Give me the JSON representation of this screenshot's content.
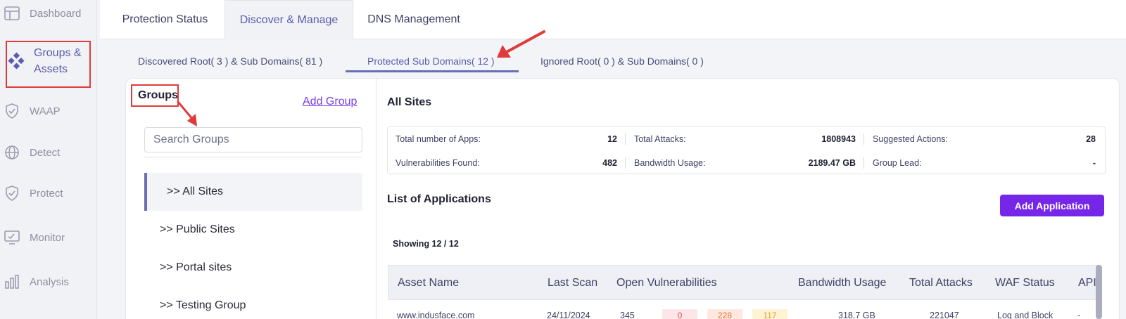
{
  "sidebar": {
    "items": [
      {
        "label": "Dashboard",
        "icon": "dashboard-icon"
      },
      {
        "label": "Groups &",
        "label2": "Assets",
        "icon": "groups-assets-icon"
      },
      {
        "label": "WAAP",
        "icon": "shield-check-icon"
      },
      {
        "label": "Detect",
        "icon": "detect-globe-icon"
      },
      {
        "label": "Protect",
        "icon": "shield-check-icon"
      },
      {
        "label": "Monitor",
        "icon": "monitor-icon"
      },
      {
        "label": "Analysis",
        "icon": "bar-chart-icon"
      }
    ]
  },
  "top_tabs": [
    "Protection Status",
    "Discover & Manage",
    "DNS Management"
  ],
  "sub_tabs": [
    "Discovered Root( 3 ) & Sub Domains( 81 )",
    "Protected Sub Domains( 12 )",
    "Ignored Root( 0 ) & Sub Domains( 0 )"
  ],
  "groups": {
    "title": "Groups",
    "add_label": "Add Group",
    "search_placeholder": "Search Groups",
    "items": [
      ">> All Sites",
      ">> Public Sites",
      ">> Portal sites",
      ">> Testing Group"
    ]
  },
  "all_sites": {
    "title": "All Sites",
    "stats": [
      {
        "label": "Total number of Apps:",
        "value": "12"
      },
      {
        "label": "Total Attacks:",
        "value": "1808943"
      },
      {
        "label": "Suggested Actions:",
        "value": "28"
      },
      {
        "label": "Vulnerabilities Found:",
        "value": "482"
      },
      {
        "label": "Bandwidth Usage:",
        "value": "2189.47 GB"
      },
      {
        "label": "Group Lead:",
        "value": "-"
      }
    ]
  },
  "applications": {
    "title": "List of Applications",
    "add_label": "Add Application",
    "showing": "Showing 12 / 12",
    "columns": [
      "Asset Name",
      "Last Scan",
      "Open Vulnerabilities",
      "Bandwidth Usage",
      "Total Attacks",
      "WAF Status",
      "API"
    ],
    "rows": [
      {
        "asset": "www.indusface.com",
        "last_scan": "24/11/2024",
        "vulns_total": "345",
        "critical": "0",
        "high": "228",
        "medium": "117",
        "bandwidth": "318.7 GB",
        "attacks": "221047",
        "waf": "Log and Block",
        "api": "-"
      }
    ]
  },
  "colors": {
    "accent": "#5a5cae",
    "button": "#7626e8",
    "annotation": "#e03b3b"
  }
}
